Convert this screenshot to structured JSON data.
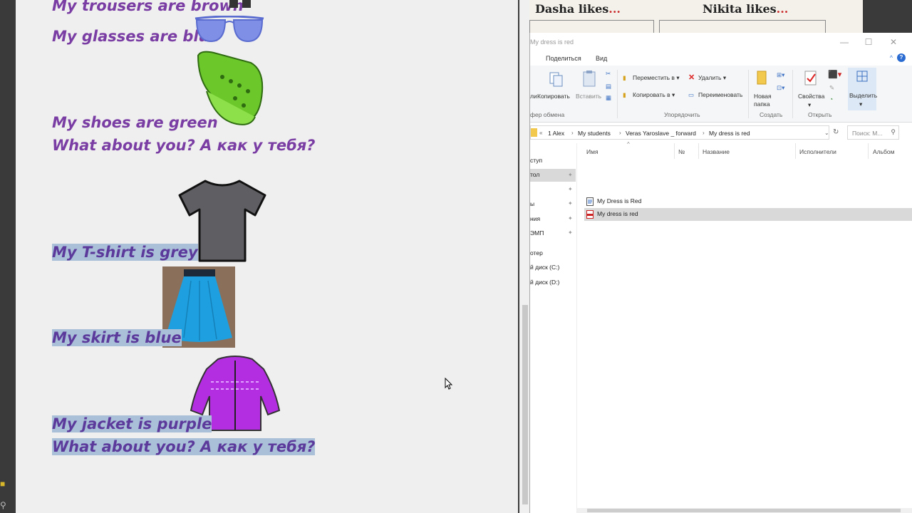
{
  "document": {
    "lines": [
      {
        "text": "My trousers are brown",
        "highlighted": false
      },
      {
        "text": "My glasses are blue",
        "highlighted": false
      },
      {
        "text": "My shoes are green",
        "highlighted": false
      },
      {
        "text": "What about you? А как у тебя?",
        "highlighted": false
      },
      {
        "text": "My T-shirt is grey",
        "highlighted": true
      },
      {
        "text": "My skirt is blue",
        "highlighted": true
      },
      {
        "text": "My jacket is purple",
        "highlighted": true
      },
      {
        "text": "What about you? А как у тебя?",
        "highlighted": true
      }
    ],
    "text_color": "#7a3da3",
    "highlight_color": "#a9c0d8"
  },
  "book": {
    "left_name": "Dasha",
    "left_verb": "likes",
    "left_ellipsis": "...",
    "right_name": "Nikita",
    "right_verb": "likes",
    "right_ellipsis": "..."
  },
  "explorer": {
    "title": "My dress is red",
    "tabs": [
      "Поделиться",
      "Вид"
    ],
    "ribbon": {
      "copy_path_label": "ли",
      "copy": "Копировать",
      "paste": "Вставить",
      "clipboard_group": "фер обмена",
      "move_to": "Переместить в",
      "copy_to": "Копировать в",
      "delete": "Удалить",
      "rename": "Переименовать",
      "organize_group": "Упорядочить",
      "new_folder_line1": "Новая",
      "new_folder_line2": "папка",
      "create_group": "Создать",
      "properties": "Свойства",
      "open_group": "Открыть",
      "select": "Выделить"
    },
    "address": {
      "crumbs": [
        "1 Alex",
        "My students",
        "Veras Yaroslave _ forward",
        "My dress is red"
      ],
      "search_placeholder": "Поиск: M..."
    },
    "nav_items": [
      {
        "label": "ступ"
      },
      {
        "label": "тол"
      },
      {
        "label": "ы"
      },
      {
        "label": "ния"
      },
      {
        "label": "ЭМП"
      },
      {
        "label": "отер"
      },
      {
        "label": "й диск (C:)"
      },
      {
        "label": "й диск (D:)"
      }
    ],
    "columns": [
      "Имя",
      "№",
      "Название",
      "Исполнители",
      "Альбом"
    ],
    "files": [
      {
        "name": "My Dress is Red",
        "type": "doc",
        "selected": false
      },
      {
        "name": "My dress is red",
        "type": "pdf",
        "selected": true
      }
    ],
    "accent_color": "#2a6bd1"
  }
}
